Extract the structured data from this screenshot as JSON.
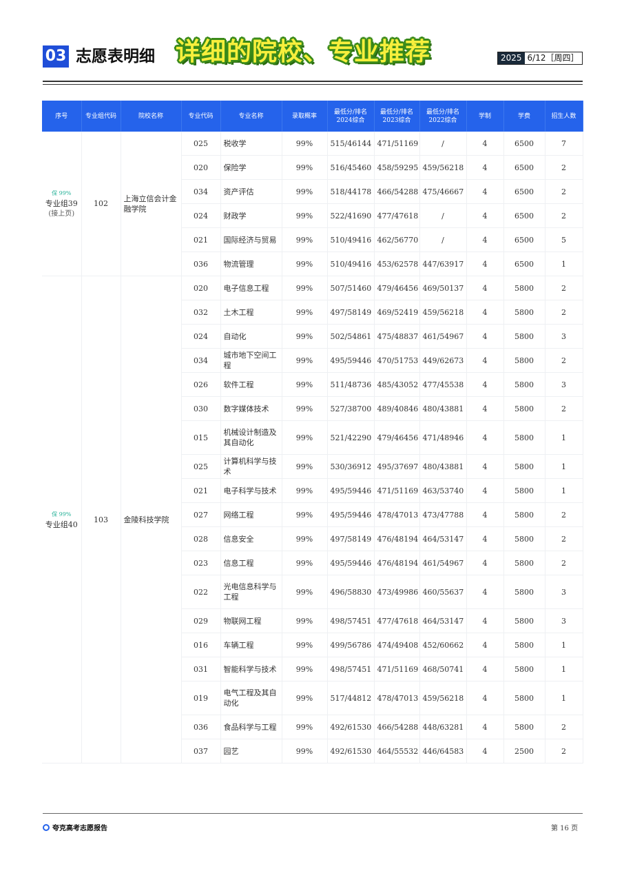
{
  "header": {
    "section_number": "03",
    "section_title": "志愿表明细",
    "banner": "详细的院校、专业推荐",
    "year": "2025",
    "date": "6/12［周四］"
  },
  "table": {
    "columns": [
      "序号",
      "专业组代码",
      "院校名称",
      "专业代码",
      "专业名称",
      "录取概率",
      "最低分/排名\n2024综合",
      "最低分/排名\n2023综合",
      "最低分/排名\n2022综合",
      "学制",
      "学费",
      "招生人数"
    ],
    "groups": [
      {
        "prob_tag": "保 99%",
        "group_label": "专业组39",
        "group_sub": "(接上页)",
        "group_code": "102",
        "college": "上海立信会计金融学院",
        "rows": [
          {
            "code": "025",
            "name": "税收学",
            "prob": "99%",
            "s2024": "515/46144",
            "s2023": "471/51169",
            "s2022": "/",
            "years": "4",
            "fee": "6500",
            "count": "7"
          },
          {
            "code": "020",
            "name": "保险学",
            "prob": "99%",
            "s2024": "516/45460",
            "s2023": "458/59295",
            "s2022": "459/56218",
            "years": "4",
            "fee": "6500",
            "count": "2"
          },
          {
            "code": "034",
            "name": "资产评估",
            "prob": "99%",
            "s2024": "518/44178",
            "s2023": "466/54288",
            "s2022": "475/46667",
            "years": "4",
            "fee": "6500",
            "count": "2"
          },
          {
            "code": "024",
            "name": "财政学",
            "prob": "99%",
            "s2024": "522/41690",
            "s2023": "477/47618",
            "s2022": "/",
            "years": "4",
            "fee": "6500",
            "count": "2"
          },
          {
            "code": "021",
            "name": "国际经济与贸易",
            "prob": "99%",
            "s2024": "510/49416",
            "s2023": "462/56770",
            "s2022": "/",
            "years": "4",
            "fee": "6500",
            "count": "5"
          },
          {
            "code": "036",
            "name": "物流管理",
            "prob": "99%",
            "s2024": "510/49416",
            "s2023": "453/62578",
            "s2022": "447/63917",
            "years": "4",
            "fee": "6500",
            "count": "1"
          }
        ]
      },
      {
        "prob_tag": "保 99%",
        "group_label": "专业组40",
        "group_sub": "",
        "group_code": "103",
        "college": "金陵科技学院",
        "rows": [
          {
            "code": "020",
            "name": "电子信息工程",
            "prob": "99%",
            "s2024": "507/51460",
            "s2023": "479/46456",
            "s2022": "469/50137",
            "years": "4",
            "fee": "5800",
            "count": "2"
          },
          {
            "code": "032",
            "name": "土木工程",
            "prob": "99%",
            "s2024": "497/58149",
            "s2023": "469/52419",
            "s2022": "459/56218",
            "years": "4",
            "fee": "5800",
            "count": "2"
          },
          {
            "code": "024",
            "name": "自动化",
            "prob": "99%",
            "s2024": "502/54861",
            "s2023": "475/48837",
            "s2022": "461/54967",
            "years": "4",
            "fee": "5800",
            "count": "3"
          },
          {
            "code": "034",
            "name": "城市地下空间工程",
            "prob": "99%",
            "s2024": "495/59446",
            "s2023": "470/51753",
            "s2022": "449/62673",
            "years": "4",
            "fee": "5800",
            "count": "2"
          },
          {
            "code": "026",
            "name": "软件工程",
            "prob": "99%",
            "s2024": "511/48736",
            "s2023": "485/43052",
            "s2022": "477/45538",
            "years": "4",
            "fee": "5800",
            "count": "3"
          },
          {
            "code": "030",
            "name": "数字媒体技术",
            "prob": "99%",
            "s2024": "527/38700",
            "s2023": "489/40846",
            "s2022": "480/43881",
            "years": "4",
            "fee": "5800",
            "count": "2"
          },
          {
            "code": "015",
            "name": "机械设计制造及其自动化",
            "prob": "99%",
            "s2024": "521/42290",
            "s2023": "479/46456",
            "s2022": "471/48946",
            "years": "4",
            "fee": "5800",
            "count": "1",
            "tall": true
          },
          {
            "code": "025",
            "name": "计算机科学与技术",
            "prob": "99%",
            "s2024": "530/36912",
            "s2023": "495/37697",
            "s2022": "480/43881",
            "years": "4",
            "fee": "5800",
            "count": "1"
          },
          {
            "code": "021",
            "name": "电子科学与技术",
            "prob": "99%",
            "s2024": "495/59446",
            "s2023": "471/51169",
            "s2022": "463/53740",
            "years": "4",
            "fee": "5800",
            "count": "1"
          },
          {
            "code": "027",
            "name": "网络工程",
            "prob": "99%",
            "s2024": "495/59446",
            "s2023": "478/47013",
            "s2022": "473/47788",
            "years": "4",
            "fee": "5800",
            "count": "2"
          },
          {
            "code": "028",
            "name": "信息安全",
            "prob": "99%",
            "s2024": "497/58149",
            "s2023": "476/48194",
            "s2022": "464/53147",
            "years": "4",
            "fee": "5800",
            "count": "2"
          },
          {
            "code": "023",
            "name": "信息工程",
            "prob": "99%",
            "s2024": "495/59446",
            "s2023": "476/48194",
            "s2022": "461/54967",
            "years": "4",
            "fee": "5800",
            "count": "2"
          },
          {
            "code": "022",
            "name": "光电信息科学与工程",
            "prob": "99%",
            "s2024": "496/58830",
            "s2023": "473/49986",
            "s2022": "460/55637",
            "years": "4",
            "fee": "5800",
            "count": "3",
            "tall": true
          },
          {
            "code": "029",
            "name": "物联网工程",
            "prob": "99%",
            "s2024": "498/57451",
            "s2023": "477/47618",
            "s2022": "464/53147",
            "years": "4",
            "fee": "5800",
            "count": "3"
          },
          {
            "code": "016",
            "name": "车辆工程",
            "prob": "99%",
            "s2024": "499/56786",
            "s2023": "474/49408",
            "s2022": "452/60662",
            "years": "4",
            "fee": "5800",
            "count": "1"
          },
          {
            "code": "031",
            "name": "智能科学与技术",
            "prob": "99%",
            "s2024": "498/57451",
            "s2023": "471/51169",
            "s2022": "468/50741",
            "years": "4",
            "fee": "5800",
            "count": "1"
          },
          {
            "code": "019",
            "name": "电气工程及其自动化",
            "prob": "99%",
            "s2024": "517/44812",
            "s2023": "478/47013",
            "s2022": "459/56218",
            "years": "4",
            "fee": "5800",
            "count": "1",
            "tall": true
          },
          {
            "code": "036",
            "name": "食品科学与工程",
            "prob": "99%",
            "s2024": "492/61530",
            "s2023": "466/54288",
            "s2022": "448/63281",
            "years": "4",
            "fee": "5800",
            "count": "2"
          },
          {
            "code": "037",
            "name": "园艺",
            "prob": "99%",
            "s2024": "492/61530",
            "s2023": "464/55532",
            "s2022": "446/64583",
            "years": "4",
            "fee": "2500",
            "count": "2"
          }
        ]
      }
    ]
  },
  "footer": {
    "brand": "夸克高考志愿报告",
    "page": "第 16 页"
  },
  "colors": {
    "header_blue": "#2563eb",
    "section_blue": "#1f4ed8",
    "prob_green": "#2bb39a",
    "banner_yellow": "#f7ef3c",
    "banner_outline": "#3a8a1a"
  }
}
